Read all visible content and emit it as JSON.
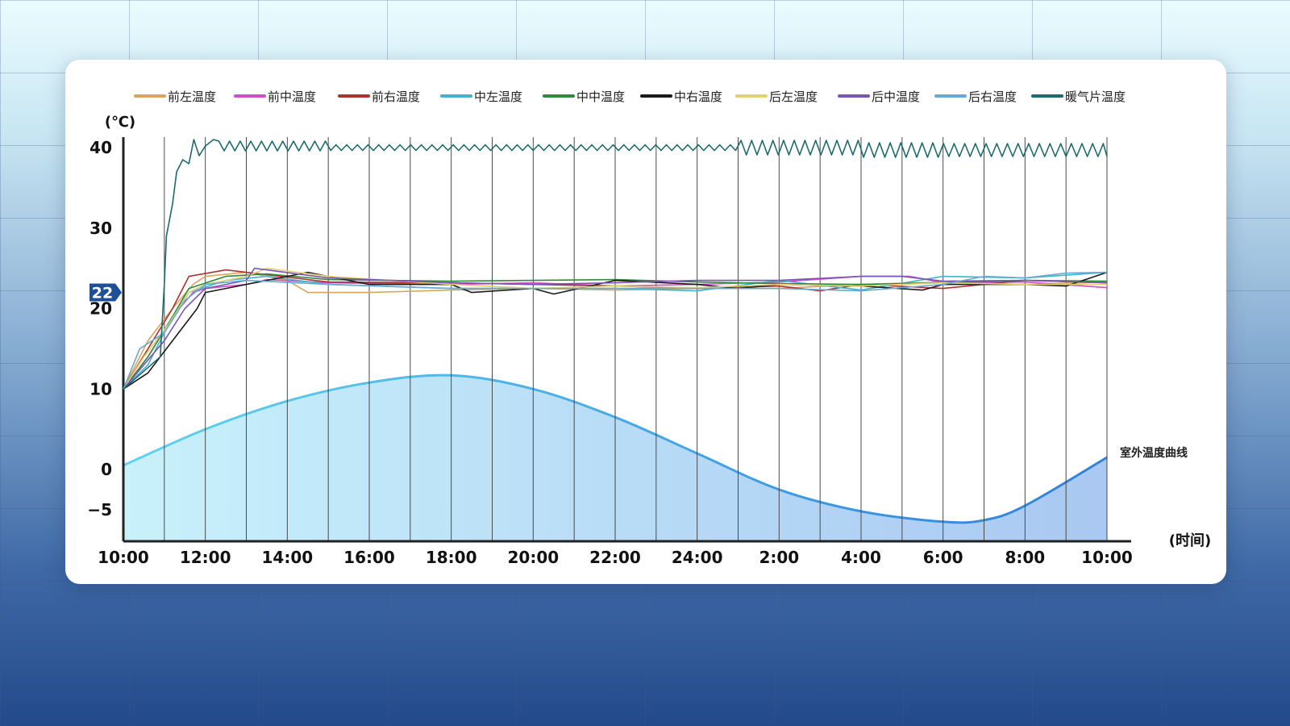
{
  "chart_data": {
    "type": "line",
    "y_unit_label": "(℃)",
    "x_unit_label": "(时间)",
    "ylim": [
      -5,
      40
    ],
    "y_ticks": [
      40,
      30,
      20,
      10,
      0,
      -5
    ],
    "y_tick_labels": [
      "40",
      "30",
      "20",
      "10",
      "0",
      "−5"
    ],
    "x_tick_labels": [
      "10:00",
      "12:00",
      "14:00",
      "16:00",
      "18:00",
      "20:00",
      "22:00",
      "24:00",
      "2:00",
      "4:00",
      "6:00",
      "8:00",
      "10:00"
    ],
    "x_hours_range": [
      0,
      24
    ],
    "highlight_value": "22",
    "grid": "vertical lines every hour",
    "legend_position": "top",
    "series": [
      {
        "name": "前左温度",
        "color": "#d9a55a",
        "values": [
          [
            0,
            10
          ],
          [
            0.6,
            16
          ],
          [
            1.2,
            20
          ],
          [
            1.7,
            23
          ],
          [
            2,
            24
          ],
          [
            3,
            24.5
          ],
          [
            4,
            23.5
          ],
          [
            4.5,
            22
          ],
          [
            6,
            22
          ],
          [
            8,
            22.3
          ],
          [
            10,
            22.5
          ],
          [
            12,
            22.3
          ],
          [
            14,
            22.5
          ],
          [
            16,
            22.5
          ],
          [
            18,
            23
          ],
          [
            20,
            23.3
          ],
          [
            22,
            23
          ],
          [
            24,
            23.3
          ]
        ]
      },
      {
        "name": "前中温度",
        "color": "#d14fc4",
        "values": [
          [
            0,
            10
          ],
          [
            0.6,
            14
          ],
          [
            1.2,
            19
          ],
          [
            1.7,
            22
          ],
          [
            2,
            22.5
          ],
          [
            3,
            23
          ],
          [
            3.5,
            23.6
          ],
          [
            5,
            23.2
          ],
          [
            8,
            23
          ],
          [
            10,
            23.2
          ],
          [
            12,
            22.8
          ],
          [
            14,
            23
          ],
          [
            16,
            23.3
          ],
          [
            18,
            24
          ],
          [
            19.2,
            24
          ],
          [
            20,
            23.2
          ],
          [
            22,
            23.3
          ],
          [
            24,
            22.6
          ]
        ]
      },
      {
        "name": "前右温度",
        "color": "#b03030",
        "values": [
          [
            0,
            10
          ],
          [
            0.6,
            15
          ],
          [
            1.2,
            20
          ],
          [
            1.6,
            24
          ],
          [
            2.5,
            24.8
          ],
          [
            3.5,
            24.2
          ],
          [
            5,
            23.3
          ],
          [
            8,
            23.2
          ],
          [
            10,
            23
          ],
          [
            12,
            22.8
          ],
          [
            14,
            22.5
          ],
          [
            16,
            22.8
          ],
          [
            17,
            22.2
          ],
          [
            18,
            23
          ],
          [
            20,
            22.5
          ],
          [
            22,
            23.5
          ],
          [
            24,
            23.2
          ]
        ]
      },
      {
        "name": "中左温度",
        "color": "#3fb4cc",
        "values": [
          [
            0,
            10
          ],
          [
            0.6,
            13
          ],
          [
            1.1,
            18
          ],
          [
            1.6,
            22
          ],
          [
            2.5,
            23.5
          ],
          [
            3.5,
            24
          ],
          [
            5,
            23
          ],
          [
            8,
            22.5
          ],
          [
            10,
            22.5
          ],
          [
            12,
            22.5
          ],
          [
            14,
            22.2
          ],
          [
            16,
            23.5
          ],
          [
            18,
            22.3
          ],
          [
            20,
            24
          ],
          [
            22,
            23.8
          ],
          [
            24,
            24.5
          ]
        ]
      },
      {
        "name": "中中温度",
        "color": "#2f8a3a",
        "values": [
          [
            0,
            10
          ],
          [
            0.6,
            14
          ],
          [
            1.2,
            19
          ],
          [
            1.6,
            22.5
          ],
          [
            2.5,
            24
          ],
          [
            3.5,
            24.3
          ],
          [
            5,
            23.6
          ],
          [
            8,
            23.4
          ],
          [
            10,
            23.5
          ],
          [
            12,
            23.6
          ],
          [
            14,
            23.3
          ],
          [
            16,
            23.1
          ],
          [
            18,
            23
          ],
          [
            20,
            23.2
          ],
          [
            22,
            23.5
          ],
          [
            24,
            23.4
          ]
        ]
      },
      {
        "name": "中右温度",
        "color": "#1a1a1a",
        "values": [
          [
            0,
            10
          ],
          [
            0.6,
            12
          ],
          [
            1.2,
            16
          ],
          [
            1.8,
            20
          ],
          [
            2,
            22
          ],
          [
            3,
            23
          ],
          [
            4.5,
            24.5
          ],
          [
            6,
            23
          ],
          [
            8,
            23
          ],
          [
            8.5,
            22
          ],
          [
            10,
            22.5
          ],
          [
            10.5,
            21.8
          ],
          [
            12,
            23.5
          ],
          [
            14,
            23
          ],
          [
            15,
            22.5
          ],
          [
            16,
            23
          ],
          [
            18,
            22.8
          ],
          [
            19.5,
            22.3
          ],
          [
            20,
            23
          ],
          [
            22,
            23
          ],
          [
            23,
            22.8
          ],
          [
            24,
            24.5
          ]
        ]
      },
      {
        "name": "后左温度",
        "color": "#e3d070",
        "values": [
          [
            0,
            10
          ],
          [
            0.5,
            14
          ],
          [
            1.1,
            18
          ],
          [
            1.6,
            22
          ],
          [
            2,
            23
          ],
          [
            3,
            24
          ],
          [
            3.5,
            25
          ],
          [
            5,
            24
          ],
          [
            8,
            23
          ],
          [
            10,
            22.5
          ],
          [
            12,
            22.8
          ],
          [
            14,
            22.6
          ],
          [
            16,
            23
          ],
          [
            18,
            22.8
          ],
          [
            20,
            23.2
          ],
          [
            22,
            23
          ],
          [
            24,
            23
          ]
        ]
      },
      {
        "name": "后中温度",
        "color": "#7a55b3",
        "values": [
          [
            0,
            10
          ],
          [
            0.5,
            13
          ],
          [
            1,
            16
          ],
          [
            1.5,
            20
          ],
          [
            2,
            22.5
          ],
          [
            3,
            23.5
          ],
          [
            3.2,
            25
          ],
          [
            5,
            23.8
          ],
          [
            8,
            23.2
          ],
          [
            10,
            23
          ],
          [
            12,
            23.2
          ],
          [
            14,
            23.5
          ],
          [
            16,
            23.5
          ],
          [
            18,
            24
          ],
          [
            19,
            24
          ],
          [
            20,
            23.4
          ],
          [
            22,
            23.5
          ],
          [
            24,
            23.2
          ]
        ]
      },
      {
        "name": "后右温度",
        "color": "#66abd6",
        "values": [
          [
            0,
            10
          ],
          [
            0.4,
            15
          ],
          [
            1,
            17
          ],
          [
            1.5,
            21
          ],
          [
            2,
            23
          ],
          [
            3,
            23.5
          ],
          [
            5,
            23
          ],
          [
            8,
            22.5
          ],
          [
            10,
            22.5
          ],
          [
            12,
            22.5
          ],
          [
            14,
            22.5
          ],
          [
            16,
            22.5
          ],
          [
            18,
            22.2
          ],
          [
            20,
            23
          ],
          [
            21,
            24
          ],
          [
            22,
            23.8
          ],
          [
            23,
            24.4
          ],
          [
            24,
            24.5
          ]
        ]
      }
    ],
    "radiator_series": {
      "name": "暖气片温度",
      "color": "#1c6a6e"
    },
    "outdoor_series": {
      "name": "室外温度曲线",
      "color": "#3b86d8",
      "values": [
        [
          0,
          0.5
        ],
        [
          2,
          5
        ],
        [
          4,
          8.5
        ],
        [
          6,
          10.8
        ],
        [
          8,
          11.7
        ],
        [
          10,
          10
        ],
        [
          12,
          6.5
        ],
        [
          14,
          2
        ],
        [
          16,
          -2.5
        ],
        [
          18,
          -5.2
        ],
        [
          20,
          -6.5
        ],
        [
          21,
          -6.3
        ],
        [
          22,
          -4.5
        ],
        [
          24,
          1.5
        ]
      ]
    }
  }
}
